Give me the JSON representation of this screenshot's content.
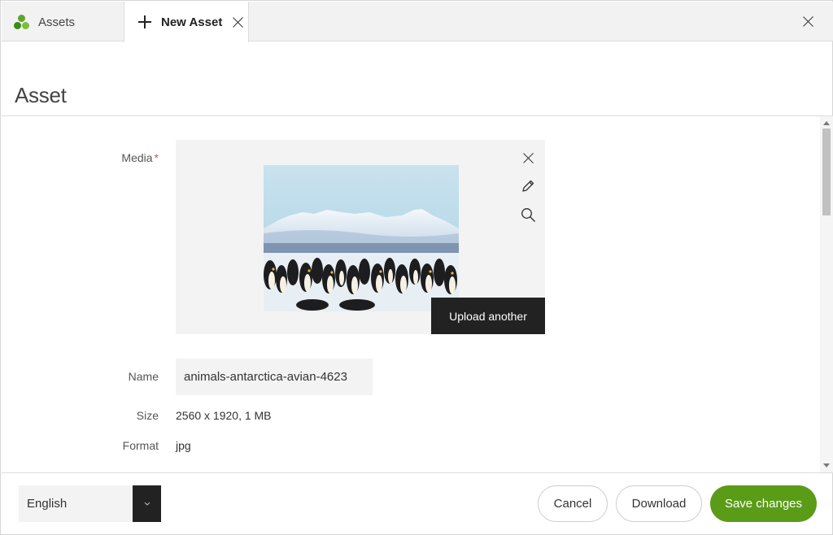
{
  "tabs": [
    {
      "label": "Assets",
      "icon": "assets-logo-icon"
    },
    {
      "label": "New Asset",
      "icon": "plus-icon"
    }
  ],
  "page": {
    "title": "Asset"
  },
  "form": {
    "media_label": "Media",
    "required_mark": "*",
    "upload_another": "Upload another",
    "name_label": "Name",
    "name_value": "animals-antarctica-avian-4623",
    "size_label": "Size",
    "size_value": "2560 x 1920, 1 MB",
    "format_label": "Format",
    "format_value": "jpg"
  },
  "footer": {
    "language": "English",
    "cancel": "Cancel",
    "download": "Download",
    "save": "Save changes"
  },
  "colors": {
    "accent": "#5a9b18",
    "dark": "#222222",
    "field_bg": "#f3f3f3",
    "required": "#d9534f"
  }
}
